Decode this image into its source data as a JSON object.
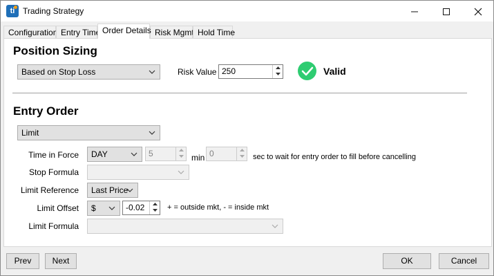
{
  "window": {
    "title": "Trading Strategy",
    "app_icon_letter": "ti"
  },
  "tabs": [
    {
      "label": "Configuration"
    },
    {
      "label": "Entry Time"
    },
    {
      "label": "Order Details"
    },
    {
      "label": "Risk Mgmt"
    },
    {
      "label": "Hold Time"
    }
  ],
  "active_tab": "Order Details",
  "position_sizing": {
    "heading": "Position Sizing",
    "method": "Based on Stop Loss",
    "risk_value_label": "Risk Value",
    "risk_value": "250",
    "status": "Valid",
    "status_color": "#2ecc71"
  },
  "entry_order": {
    "heading": "Entry Order",
    "order_type": "Limit",
    "time_in_force_label": "Time in Force",
    "time_in_force": "DAY",
    "tif_value": "5",
    "min_label": "min",
    "sec_value": "0",
    "sec_text": "sec to wait for entry order to fill before cancelling",
    "stop_formula_label": "Stop Formula",
    "stop_formula": "",
    "limit_reference_label": "Limit Reference",
    "limit_reference": "Last Price",
    "limit_offset_label": "Limit Offset",
    "limit_offset_unit": "$",
    "limit_offset_value": "-0.02",
    "limit_offset_hint": "+ = outside mkt, - = inside mkt",
    "limit_formula_label": "Limit Formula",
    "limit_formula": ""
  },
  "footer": {
    "prev": "Prev",
    "next": "Next",
    "ok": "OK",
    "cancel": "Cancel"
  }
}
